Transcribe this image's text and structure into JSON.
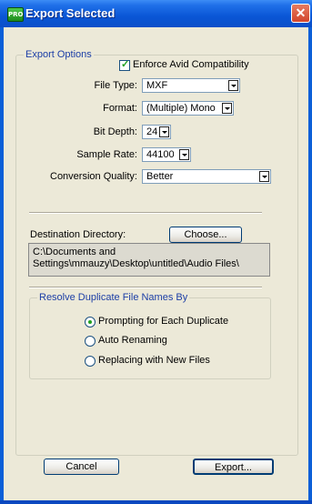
{
  "window": {
    "title": "Export Selected",
    "icon_label": "PRO",
    "close_glyph": "✕"
  },
  "export_options": {
    "group_label": "Export Options",
    "enforce_avid_label": "Enforce Avid Compatibility",
    "enforce_avid_checked": true,
    "file_type_label": "File Type:",
    "file_type_value": "MXF",
    "format_label": "Format:",
    "format_value": "(Multiple) Mono",
    "bit_depth_label": "Bit Depth:",
    "bit_depth_value": "24",
    "sample_rate_label": "Sample Rate:",
    "sample_rate_value": "44100",
    "conversion_quality_label": "Conversion Quality:",
    "conversion_quality_value": "Better"
  },
  "destination": {
    "label": "Destination Directory:",
    "choose_label": "Choose...",
    "path_line1": "C:\\Documents and",
    "path_line2": "Settings\\mmauzy\\Desktop\\untitled\\Audio Files\\"
  },
  "duplicates": {
    "group_label": "Resolve Duplicate File Names By",
    "options": [
      {
        "label": "Prompting for Each Duplicate",
        "selected": true
      },
      {
        "label": "Auto Renaming",
        "selected": false
      },
      {
        "label": "Replacing with New Files",
        "selected": false
      }
    ]
  },
  "buttons": {
    "cancel_label": "Cancel",
    "export_label": "Export..."
  },
  "colors": {
    "titlebar": "#0a56d6",
    "dialog_bg": "#ece9d8",
    "group_label": "#1c3ea6",
    "check_accent": "#21a121"
  }
}
